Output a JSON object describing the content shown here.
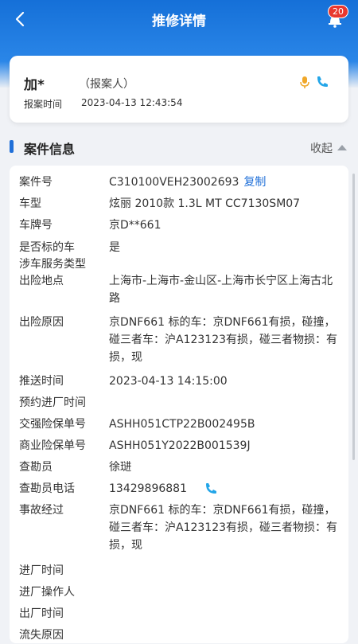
{
  "header": {
    "title": "推修详情",
    "badge_count": "20"
  },
  "reporter": {
    "name": "加*",
    "role": "（报案人）",
    "time_label": "报案时间",
    "time": "2023-04-13 12:43:54"
  },
  "section": {
    "title": "案件信息",
    "collapse_label": "收起"
  },
  "fields": {
    "case_no": {
      "label": "案件号",
      "value": "C310100VEH23002693",
      "copy": "复制"
    },
    "car_model": {
      "label": "车型",
      "value": "炫丽 2010款 1.3L MT CC7130SM07"
    },
    "plate": {
      "label": "车牌号",
      "value": "京D**661"
    },
    "is_target": {
      "label": "是否标的车",
      "value": "是"
    },
    "service_type": {
      "label": "涉车服务类型",
      "value": ""
    },
    "location": {
      "label": "出险地点",
      "value": "上海市-上海市-金山区-上海市长宁区上海古北路"
    },
    "reason": {
      "label": "出险原因",
      "value": "京DNF661 标的车：京DNF661有损，碰撞，碰三者车：沪A123123有损，碰三者物损：有损，现"
    },
    "push_time": {
      "label": "推送时间",
      "value": "2023-04-13 14:15:00"
    },
    "appointment": {
      "label": "预约进厂时间",
      "value": ""
    },
    "compulsory_policy": {
      "label": "交强险保单号",
      "value": "ASHH051CTP22B002495B"
    },
    "commercial_policy": {
      "label": "商业险保单号",
      "value": "ASHH051Y2022B001539J"
    },
    "surveyor": {
      "label": "查勘员",
      "value": "徐琎"
    },
    "surveyor_phone": {
      "label": "查勘员电话",
      "value": "13429896881"
    },
    "accident": {
      "label": "事故经过",
      "value": "京DNF661 标的车：京DNF661有损，碰撞，碰三者车：沪A123123有损，碰三者物损：有损，现"
    },
    "enter_time": {
      "label": "进厂时间",
      "value": ""
    },
    "enter_operator": {
      "label": "进厂操作人",
      "value": ""
    },
    "exit_time": {
      "label": "出厂时间",
      "value": ""
    },
    "lost_reason": {
      "label": "流失原因",
      "value": ""
    }
  }
}
